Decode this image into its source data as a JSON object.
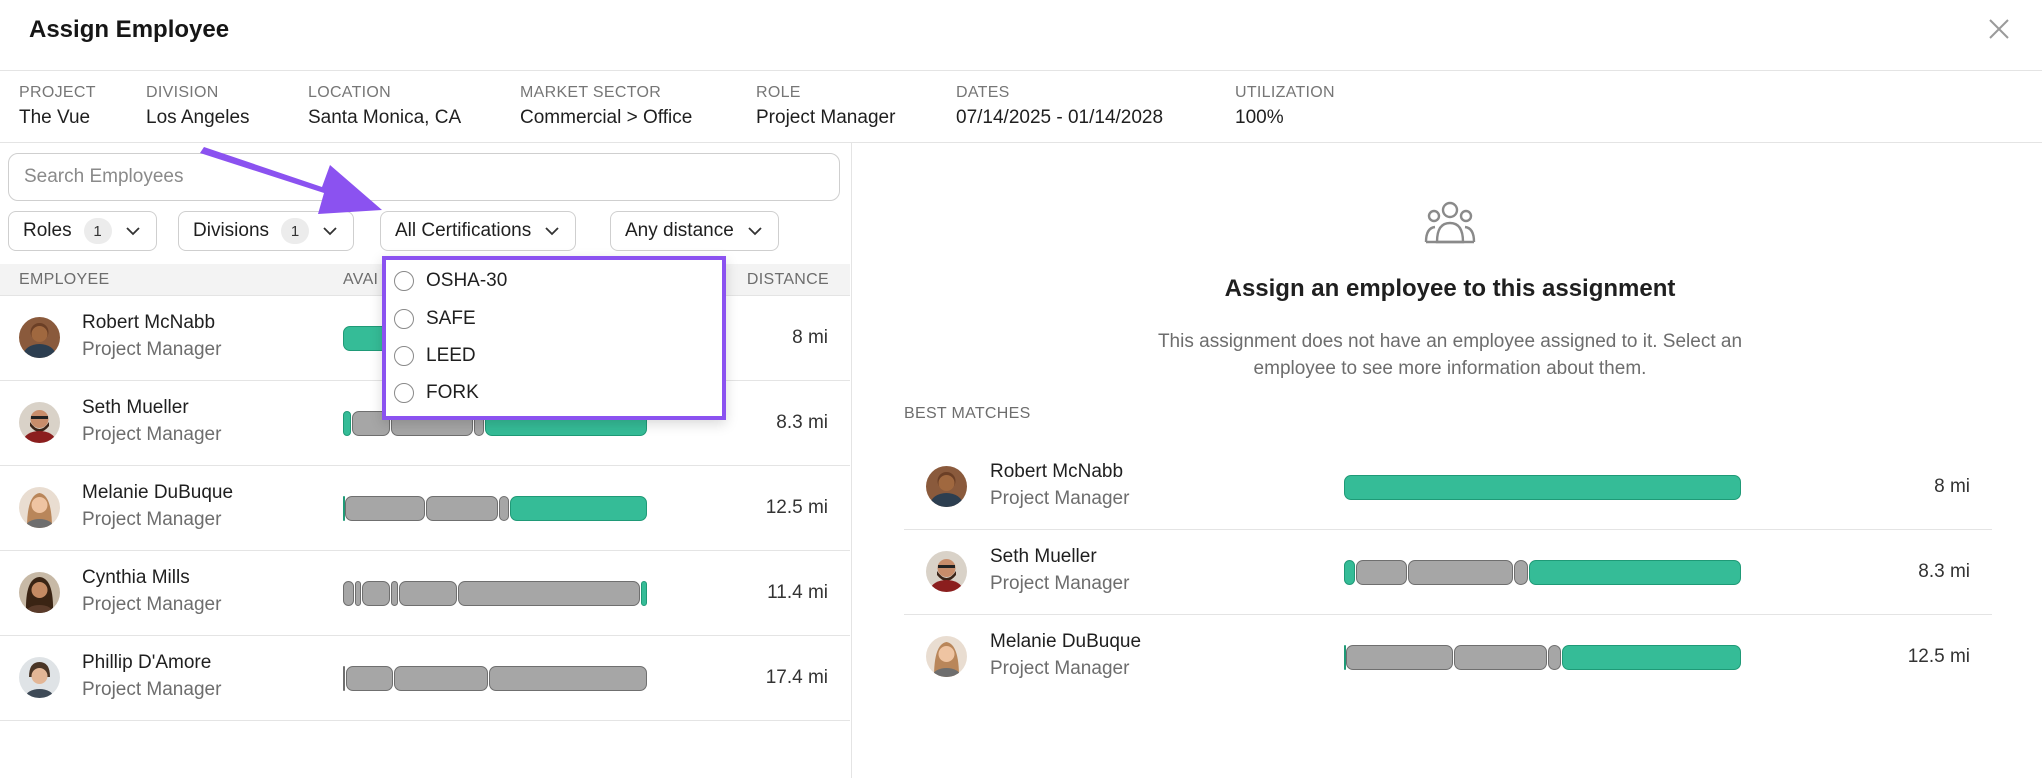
{
  "header": {
    "title": "Assign Employee"
  },
  "info": [
    {
      "label": "PROJECT",
      "value": "The Vue"
    },
    {
      "label": "DIVISION",
      "value": "Los Angeles"
    },
    {
      "label": "LOCATION",
      "value": "Santa Monica, CA"
    },
    {
      "label": "MARKET SECTOR",
      "value": "Commercial > Office"
    },
    {
      "label": "ROLE",
      "value": "Project Manager"
    },
    {
      "label": "DATES",
      "value": "07/14/2025 - 01/14/2028"
    },
    {
      "label": "UTILIZATION",
      "value": "100%"
    }
  ],
  "search": {
    "placeholder": "Search Employees"
  },
  "filters": {
    "roles": {
      "label": "Roles",
      "count": "1"
    },
    "divisions": {
      "label": "Divisions",
      "count": "1"
    },
    "certifications": {
      "label": "All Certifications"
    },
    "distance": {
      "label": "Any distance"
    }
  },
  "table": {
    "headers": {
      "employee": "EMPLOYEE",
      "availability": "AVAI",
      "distance": "DISTANCE"
    },
    "rows": [
      {
        "name": "Robert McNabb",
        "role": "Project Manager",
        "distance": "8 mi"
      },
      {
        "name": "Seth Mueller",
        "role": "Project Manager",
        "distance": "8.3 mi"
      },
      {
        "name": "Melanie DuBuque",
        "role": "Project Manager",
        "distance": "12.5 mi"
      },
      {
        "name": "Cynthia Mills",
        "role": "Project Manager",
        "distance": "11.4 mi"
      },
      {
        "name": "Phillip D'Amore",
        "role": "Project Manager",
        "distance": "17.4 mi"
      }
    ]
  },
  "certifications_menu": {
    "options": [
      "OSHA-30",
      "SAFE",
      "LEED",
      "FORK"
    ]
  },
  "empty_state": {
    "title": "Assign an employee to this assignment",
    "description": "This assignment does not have an employee assigned to it. Select an employee to see more information about them."
  },
  "best_matches": {
    "label": "BEST MATCHES",
    "rows": [
      {
        "name": "Robert McNabb",
        "role": "Project Manager",
        "distance": "8 mi"
      },
      {
        "name": "Seth Mueller",
        "role": "Project Manager",
        "distance": "8.3 mi"
      },
      {
        "name": "Melanie DuBuque",
        "role": "Project Manager",
        "distance": "12.5 mi"
      }
    ]
  },
  "colors": {
    "accent": "#8b52f0",
    "available": "#35bc97",
    "busy": "#a6a6a6"
  },
  "icons": {
    "close": "close-icon",
    "chevron": "chevron-down-icon",
    "people": "people-group-icon"
  }
}
